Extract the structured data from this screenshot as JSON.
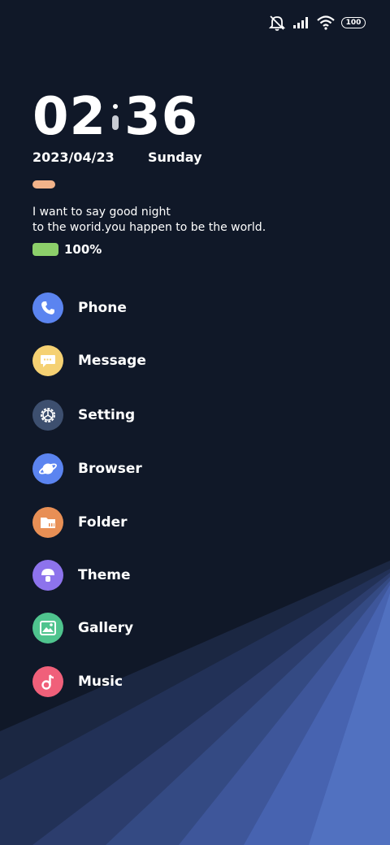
{
  "status_bar": {
    "battery_level": "100"
  },
  "clock": {
    "hours": "02",
    "minutes": "36"
  },
  "date": {
    "date": "2023/04/23",
    "weekday": "Sunday"
  },
  "quote": {
    "line1": "I want to say good night",
    "line2": "to the worid.you happen to be the world."
  },
  "battery": {
    "percent_text": "100%",
    "level": 1.0,
    "color": "#8ccf6a"
  },
  "apps": [
    {
      "label": "Phone",
      "icon": "phone-icon",
      "color": "#5b84f0"
    },
    {
      "label": "Message",
      "icon": "message-icon",
      "color": "#f5d173"
    },
    {
      "label": "Setting",
      "icon": "gear-icon",
      "color": "#3d4f6f"
    },
    {
      "label": "Browser",
      "icon": "planet-icon",
      "color": "#5b84f0"
    },
    {
      "label": "Folder",
      "icon": "folder-icon",
      "color": "#e88f55"
    },
    {
      "label": "Theme",
      "icon": "brush-icon",
      "color": "#8d73ec"
    },
    {
      "label": "Gallery",
      "icon": "image-icon",
      "color": "#4fc48e"
    },
    {
      "label": "Music",
      "icon": "music-note-icon",
      "color": "#f0607a"
    }
  ]
}
